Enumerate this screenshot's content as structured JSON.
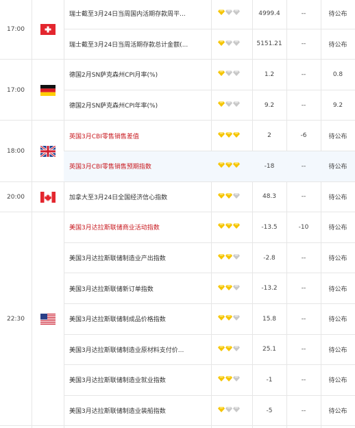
{
  "colors": {
    "important_text": "#c8191f",
    "gem_gold": "#f5c400",
    "gem_grey": "#c8c8c8",
    "highlight_row": "#f3f8fd",
    "grid": "#e6e6e6"
  },
  "groups": [
    {
      "time": "17:00",
      "flag": "switzerland-flag-icon",
      "rows": [
        {
          "name": "瑞士截至3月24日当周国内活期存款周平...",
          "stars": 1,
          "actual": "4999.4",
          "expected": "--",
          "previous": "待公布",
          "important": false,
          "highlight": false
        },
        {
          "name": "瑞士截至3月24日当周活期存款总计金额(...",
          "stars": 1,
          "actual": "5151.21",
          "expected": "--",
          "previous": "待公布",
          "important": false,
          "highlight": false
        }
      ]
    },
    {
      "time": "17:00",
      "flag": "germany-flag-icon",
      "rows": [
        {
          "name": "德国2月SN萨克森州CPI月率(%)",
          "stars": 1,
          "actual": "1.2",
          "expected": "--",
          "previous": "0.8",
          "important": false,
          "highlight": false
        },
        {
          "name": "德国2月SN萨克森州CPI年率(%)",
          "stars": 1,
          "actual": "9.2",
          "expected": "--",
          "previous": "9.2",
          "important": false,
          "highlight": false
        }
      ]
    },
    {
      "time": "18:00",
      "flag": "uk-flag-icon",
      "rows": [
        {
          "name": "英国3月CBI零售销售差值",
          "stars": 3,
          "actual": "2",
          "expected": "-6",
          "previous": "待公布",
          "important": true,
          "highlight": false
        },
        {
          "name": "英国3月CBI零售销售预期指数",
          "stars": 3,
          "actual": "-18",
          "expected": "--",
          "previous": "待公布",
          "important": true,
          "highlight": true
        }
      ]
    },
    {
      "time": "20:00",
      "flag": "canada-flag-icon",
      "rows": [
        {
          "name": "加拿大至3月24日全国经济信心指数",
          "stars": 2,
          "actual": "48.3",
          "expected": "--",
          "previous": "待公布",
          "important": false,
          "highlight": false
        }
      ]
    },
    {
      "time": "22:30",
      "flag": "usa-flag-icon",
      "rows": [
        {
          "name": "美国3月达拉斯联储商业活动指数",
          "stars": 3,
          "actual": "-13.5",
          "expected": "-10",
          "previous": "待公布",
          "important": true,
          "highlight": false
        },
        {
          "name": "美国3月达拉斯联储制造业产出指数",
          "stars": 2,
          "actual": "-2.8",
          "expected": "--",
          "previous": "待公布",
          "important": false,
          "highlight": false
        },
        {
          "name": "美国3月达拉斯联储新订单指数",
          "stars": 2,
          "actual": "-13.2",
          "expected": "--",
          "previous": "待公布",
          "important": false,
          "highlight": false
        },
        {
          "name": "美国3月达拉斯联储制成品价格指数",
          "stars": 2,
          "actual": "15.8",
          "expected": "--",
          "previous": "待公布",
          "important": false,
          "highlight": false
        },
        {
          "name": "美国3月达拉斯联储制造业原材料支付价...",
          "stars": 2,
          "actual": "25.1",
          "expected": "--",
          "previous": "待公布",
          "important": false,
          "highlight": false
        },
        {
          "name": "美国3月达拉斯联储制造业就业指数",
          "stars": 2,
          "actual": "-1",
          "expected": "--",
          "previous": "待公布",
          "important": false,
          "highlight": false
        },
        {
          "name": "美国3月达拉斯联储制造业装船指数",
          "stars": 1,
          "actual": "-5",
          "expected": "--",
          "previous": "待公布",
          "important": false,
          "highlight": false
        }
      ]
    }
  ]
}
